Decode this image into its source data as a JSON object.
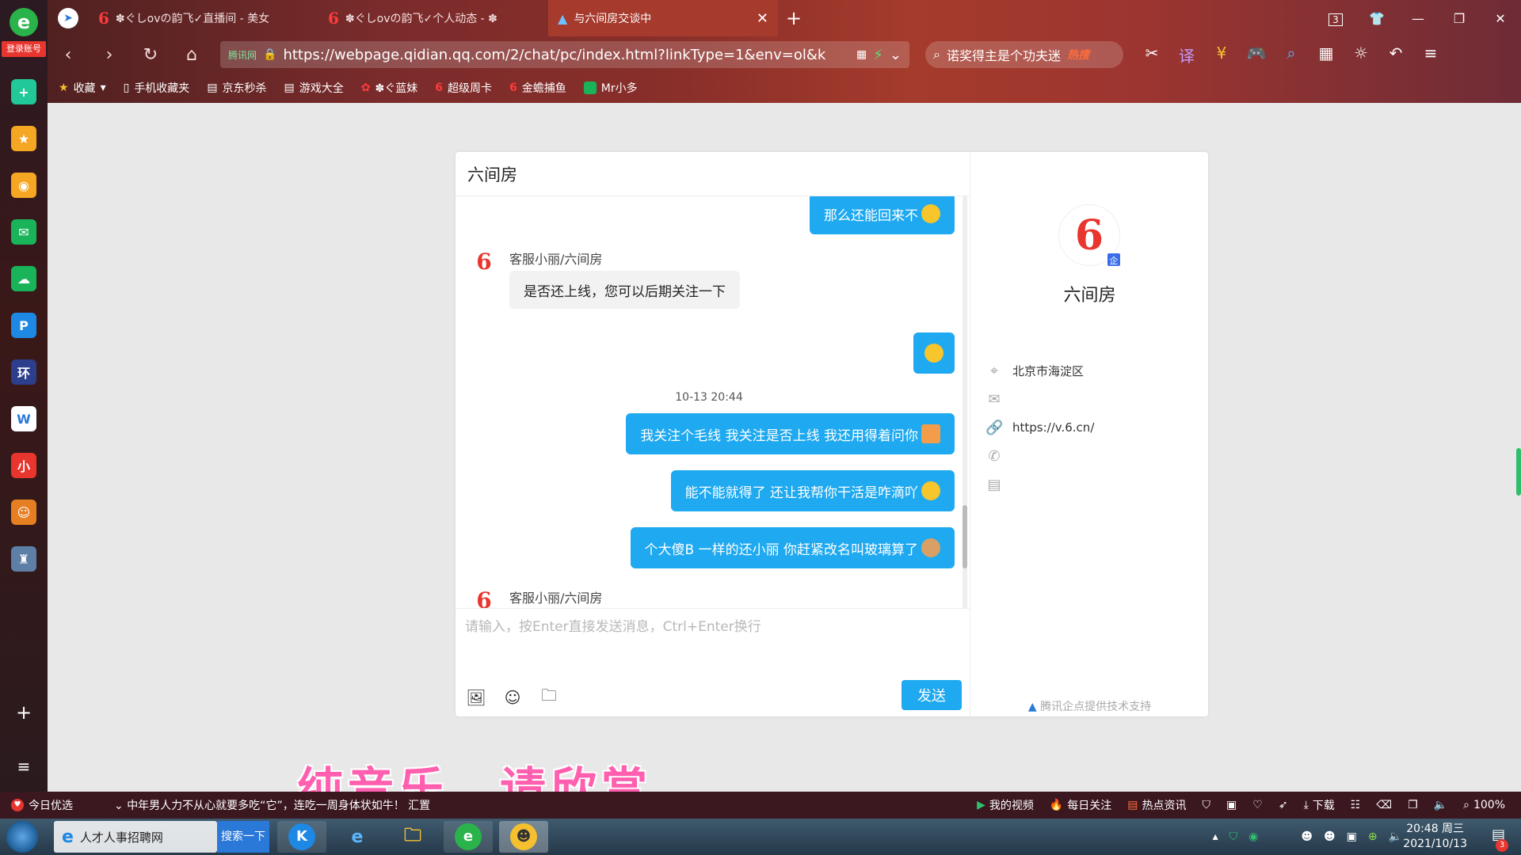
{
  "browser": {
    "tabs": [
      {
        "label": "✽ぐしovの韵飞✓直播间 - 美女",
        "active": false
      },
      {
        "label": "✽ぐしovの韵飞✓个人动态 - ✽",
        "active": false
      },
      {
        "label": "与六间房交谈中",
        "active": true
      }
    ],
    "window_controls": {
      "tab_count": "3"
    },
    "address": {
      "tag": "腾讯网",
      "url": "https://webpage.qidian.qq.com/2/chat/pc/index.html?linkType=1&env=ol&k"
    },
    "search": {
      "text": "诺奖得主是个功夫迷",
      "hot_label": "热搜"
    },
    "bookmarks": [
      {
        "label": "收藏",
        "icon": "star-icon"
      },
      {
        "label": "手机收藏夹",
        "icon": "phone-icon"
      },
      {
        "label": "京东秒杀",
        "icon": "page-icon"
      },
      {
        "label": "游戏大全",
        "icon": "page-icon"
      },
      {
        "label": "✽ぐ蓝妹",
        "icon": "flower-icon"
      },
      {
        "label": "超级周卡",
        "icon": "six-icon"
      },
      {
        "label": "金蟾捕鱼",
        "icon": "six-icon"
      },
      {
        "label": "Mr小多",
        "icon": "green-icon"
      }
    ]
  },
  "sidebar": {
    "login_label": "登录账号",
    "icons": [
      {
        "name": "plus-app-icon",
        "color": "#20c997",
        "glyph": "+"
      },
      {
        "name": "favorites-star-icon",
        "color": "#f5a623",
        "glyph": "★"
      },
      {
        "name": "weibo-icon",
        "color": "#f5a623",
        "glyph": "◉"
      },
      {
        "name": "mail-icon",
        "color": "#19b35a",
        "glyph": "✉"
      },
      {
        "name": "cloud-icon",
        "color": "#19b35a",
        "glyph": "☁"
      },
      {
        "name": "p-app-icon",
        "color": "#1e88e5",
        "glyph": "P"
      },
      {
        "name": "game-icon",
        "color": "#2c3e8c",
        "glyph": "环"
      },
      {
        "name": "document-icon",
        "color": "#ffffff",
        "glyph": "W"
      },
      {
        "name": "red-app-icon",
        "color": "#e8352e",
        "glyph": "小"
      },
      {
        "name": "avatar-game-icon",
        "color": "#e67e22",
        "glyph": "☺"
      },
      {
        "name": "castle-game-icon",
        "color": "#5d7fa6",
        "glyph": "♜"
      }
    ],
    "add_glyph": "+",
    "menu_glyph": "≡"
  },
  "chat": {
    "title": "六间房",
    "messages": [
      {
        "type": "out",
        "text": "那么还能回来不"
      },
      {
        "type": "sender",
        "text": "客服小丽/六间房"
      },
      {
        "type": "in",
        "text": "是否还上线，您可以后期关注一下"
      },
      {
        "type": "out",
        "text": ""
      },
      {
        "type": "time",
        "text": "10-13 20:44"
      },
      {
        "type": "out",
        "text": "我关注个毛线 我关注是否上线 我还用得着问你"
      },
      {
        "type": "out",
        "text": "能不能就得了 还让我帮你干活是咋滴吖"
      },
      {
        "type": "out",
        "text": "个大傻B 一样的还小丽  你赶紧改名叫玻璃算了"
      },
      {
        "type": "sender",
        "text": "客服小丽/六间房"
      }
    ],
    "input_placeholder": "请输入，按Enter直接发送消息，Ctrl+Enter换行",
    "send_label": "发送",
    "colors": {
      "accent": "#1ea9f0",
      "incoming_bg": "#f2f2f2"
    }
  },
  "profile": {
    "logo_text": "6",
    "badge": "企",
    "name": "六间房",
    "location": "北京市海淀区",
    "website": "https://v.6.cn/",
    "footer": "腾讯企点提供技术支持"
  },
  "overlay": {
    "text": "纯音乐，请欣赏"
  },
  "statusbar": {
    "today": "今日优选",
    "news": "中年男人力不从心就要多吃“它”，连吃一周身体状如牛！ 汇置",
    "items": [
      "我的视频",
      "每日关注",
      "热点资讯",
      "下载",
      "100%"
    ]
  },
  "taskbar": {
    "ie_task": "人才人事招聘网",
    "search": "搜索一下",
    "time": "20:48 周三",
    "date": "2021/10/13",
    "notif_count": "3"
  }
}
